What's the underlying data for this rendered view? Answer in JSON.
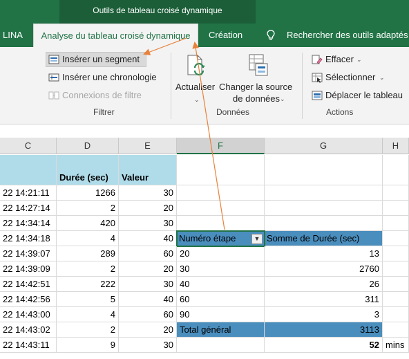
{
  "ribbon": {
    "context_title": "Outils de tableau croisé dynamique",
    "tabs": [
      {
        "label": "LINA"
      },
      {
        "label": "Analyse du tableau croisé dynamique"
      },
      {
        "label": "Création"
      },
      {
        "label": "Rechercher des outils adaptés"
      }
    ],
    "groups": {
      "filtrer": {
        "label": "Filtrer",
        "insert_slicer": "Insérer un segment",
        "insert_timeline": "Insérer une chronologie",
        "filter_connections": "Connexions de filtre"
      },
      "donnees": {
        "label": "Données",
        "refresh": "Actualiser",
        "change_source_line1": "Changer la source",
        "change_source_line2": "de données"
      },
      "actions": {
        "label": "Actions",
        "clear": "Effacer",
        "select": "Sélectionner",
        "move": "Déplacer le tableau"
      }
    }
  },
  "sheet": {
    "columns": [
      "C",
      "D",
      "E",
      "F",
      "G",
      "H"
    ],
    "header_row": {
      "duration": "Durée (sec)",
      "value": "Valeur"
    },
    "rows": [
      {
        "time": "22 14:21:11",
        "duration": "1266",
        "value": "30"
      },
      {
        "time": "22 14:27:14",
        "duration": "2",
        "value": "20"
      },
      {
        "time": "22 14:34:14",
        "duration": "420",
        "value": "30"
      },
      {
        "time": "22 14:34:18",
        "duration": "4",
        "value": "40"
      },
      {
        "time": "22 14:39:07",
        "duration": "289",
        "value": "60"
      },
      {
        "time": "22 14:39:09",
        "duration": "2",
        "value": "20"
      },
      {
        "time": "22 14:42:51",
        "duration": "222",
        "value": "30"
      },
      {
        "time": "22 14:42:56",
        "duration": "5",
        "value": "40"
      },
      {
        "time": "22 14:43:00",
        "duration": "4",
        "value": "60"
      },
      {
        "time": "22 14:43:02",
        "duration": "2",
        "value": "20"
      },
      {
        "time": "22 14:43:11",
        "duration": "9",
        "value": "30"
      }
    ],
    "pivot": {
      "row_header": "Numéro étape",
      "value_header": "Somme de Durée (sec)",
      "items": [
        {
          "step": "20",
          "sum": "13"
        },
        {
          "step": "30",
          "sum": "2760"
        },
        {
          "step": "40",
          "sum": "26"
        },
        {
          "step": "60",
          "sum": "311"
        },
        {
          "step": "90",
          "sum": "3"
        }
      ],
      "total_label": "Total général",
      "total_value": "3113"
    },
    "extra": {
      "value": "52",
      "unit": "mins"
    }
  },
  "colors": {
    "excel_green": "#217346",
    "arrow": "#e8823a",
    "pivot_blue": "#4a8ebe",
    "header_blue": "#b0dcea"
  }
}
